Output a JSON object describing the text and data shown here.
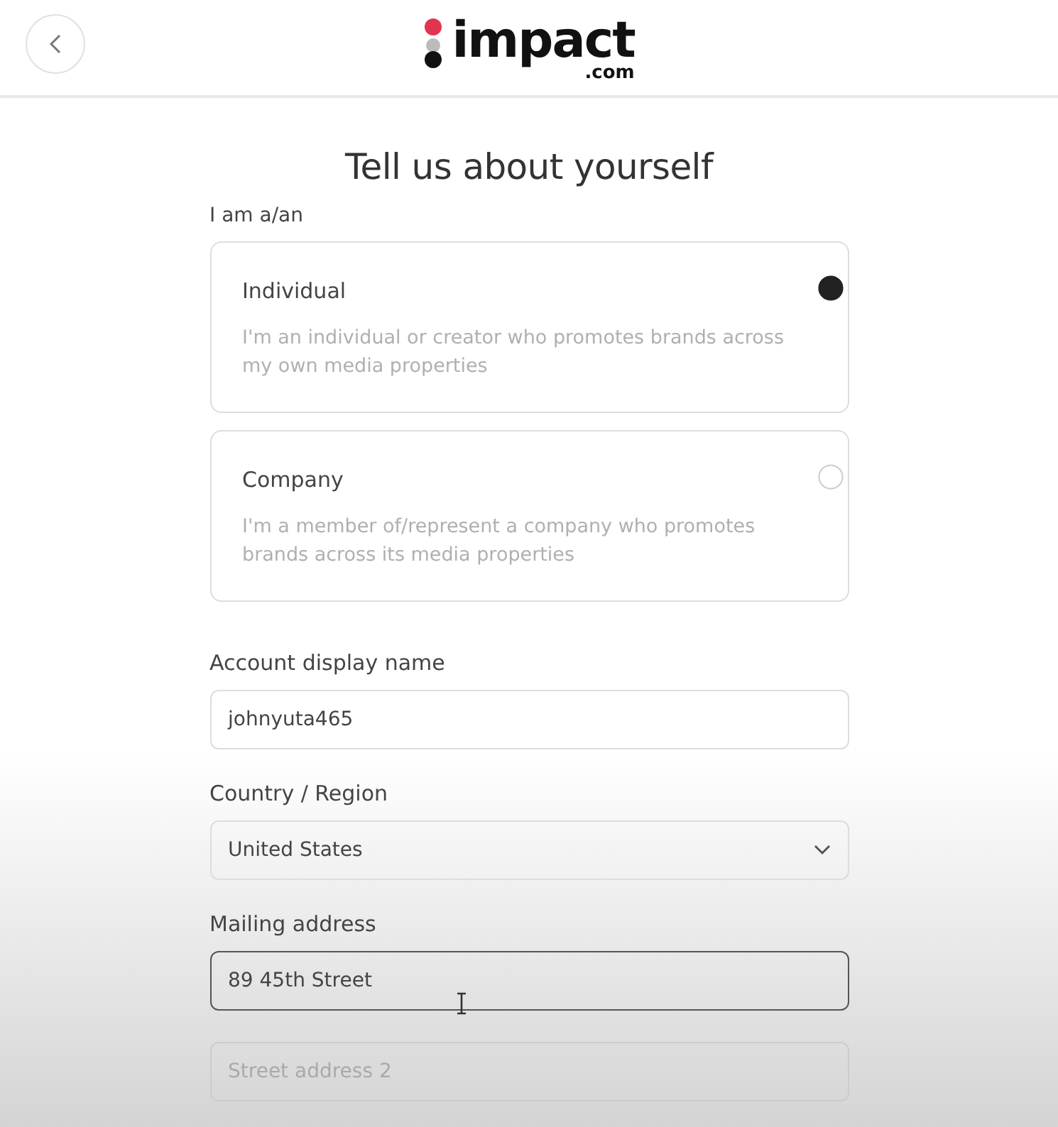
{
  "header": {
    "logo": {
      "name": "impact",
      "suffix": ".com"
    }
  },
  "title": "Tell us about yourself",
  "account_type": {
    "label": "I am a/an",
    "options": [
      {
        "title": "Individual",
        "description": "I'm an individual or creator who promotes brands across my own media properties",
        "selected": true
      },
      {
        "title": "Company",
        "description": "I'm a member of/represent a company who promotes brands across its media properties",
        "selected": false
      }
    ]
  },
  "fields": [
    {
      "kind": "text",
      "label": "Account display name",
      "value": "johnyuta465",
      "focused": false
    },
    {
      "kind": "select",
      "label": "Country / Region",
      "value": "United States",
      "focused": false
    },
    {
      "kind": "text",
      "label": "Mailing address",
      "value": "89 45th Street",
      "focused": true
    },
    {
      "kind": "text",
      "placeholder": "Street address 2",
      "focused": false
    }
  ]
}
